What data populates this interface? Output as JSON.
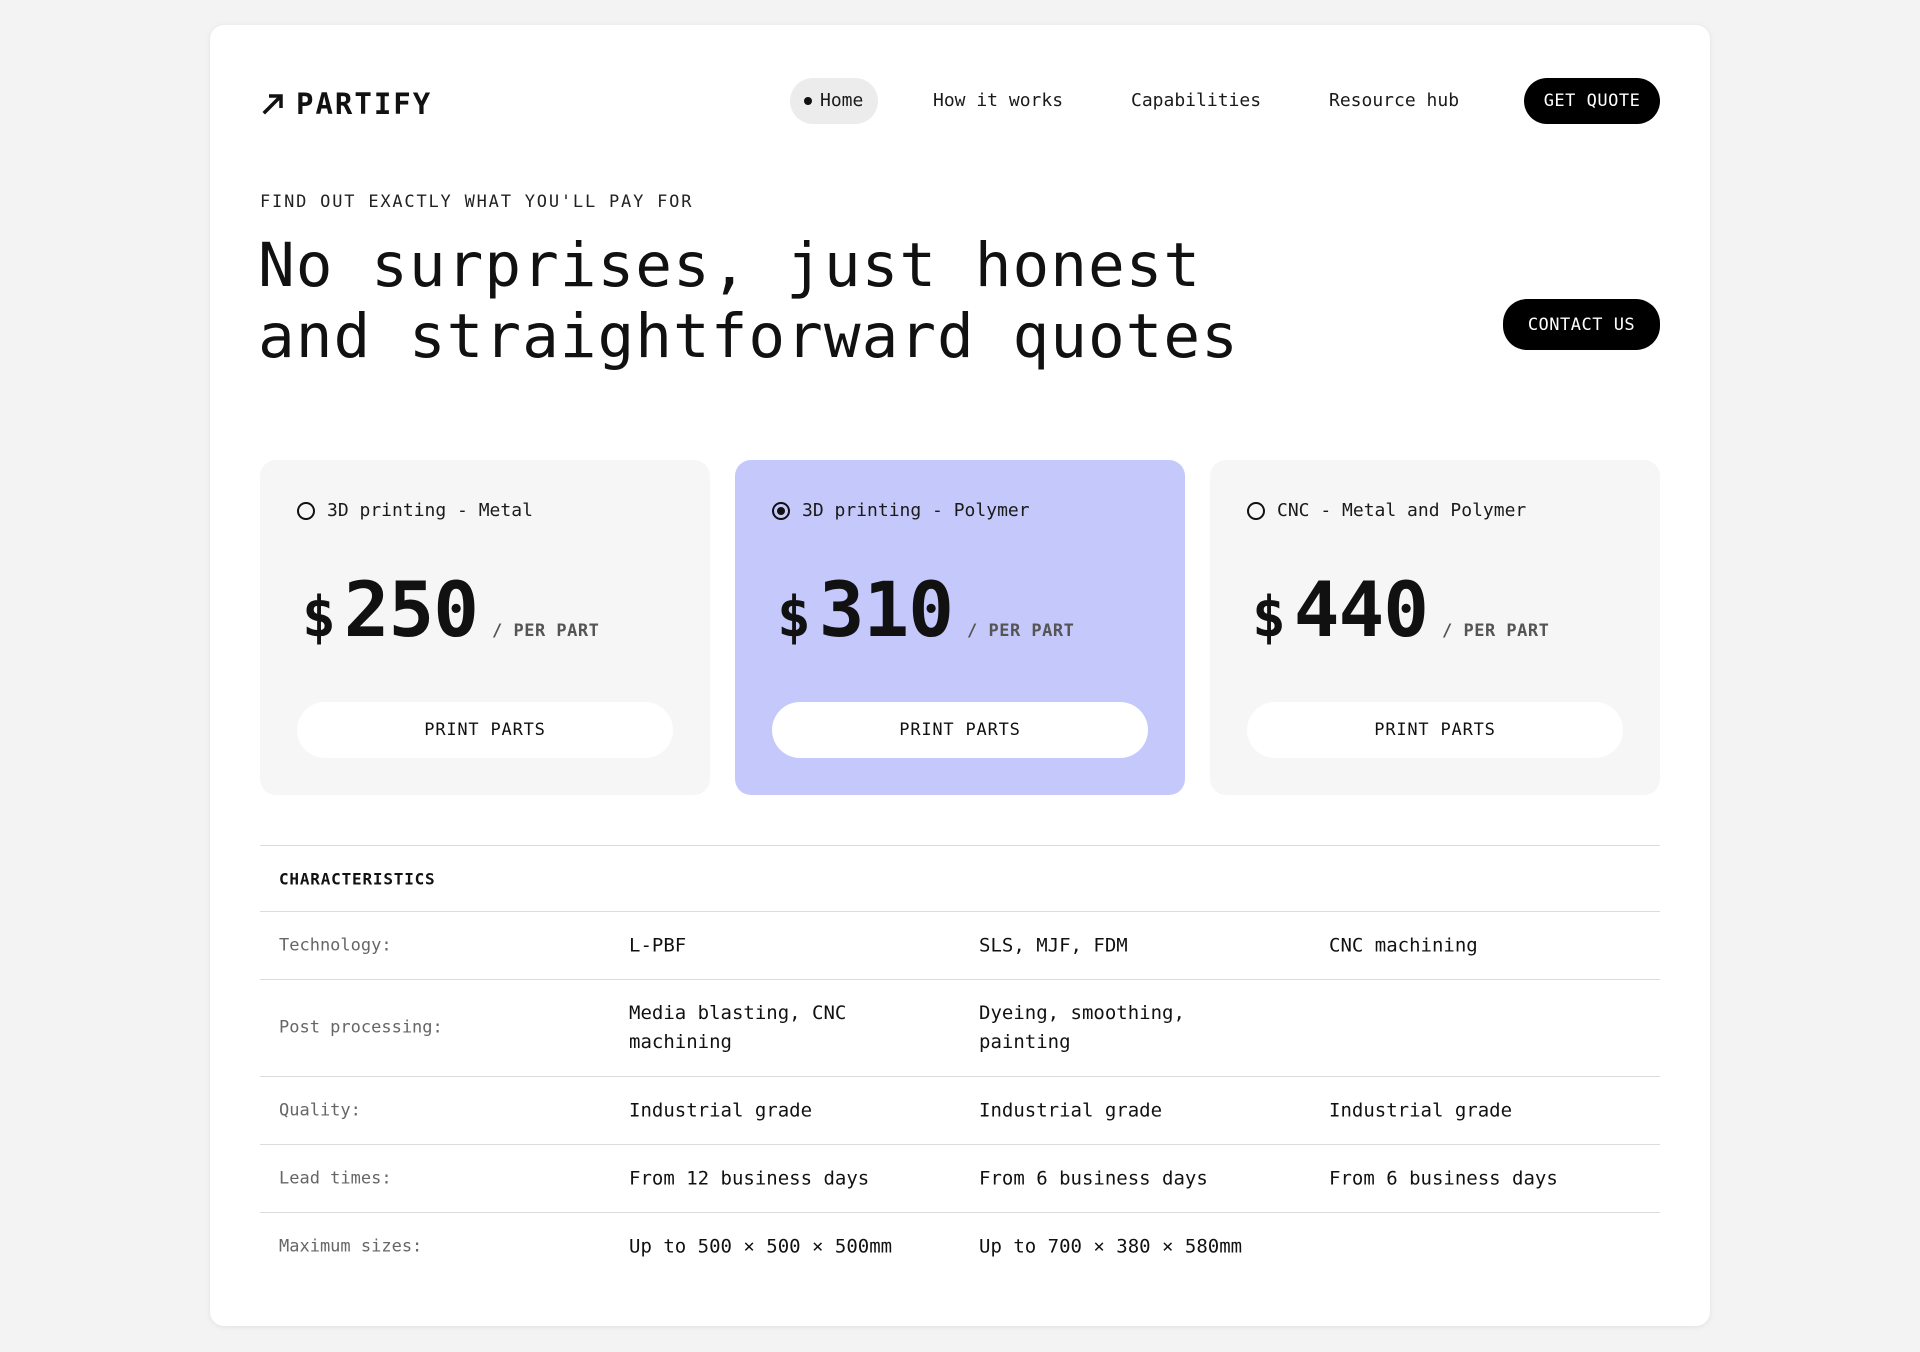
{
  "brand": {
    "name": "PARTIFY",
    "icon": "arrow-up-right-icon"
  },
  "nav": {
    "items": [
      "Home",
      "How it works",
      "Capabilities",
      "Resource hub"
    ],
    "cta": "GET QUOTE"
  },
  "hero": {
    "eyebrow": "FIND OUT EXACTLY WHAT YOU'LL PAY FOR",
    "headline_line1": "No surprises, just honest",
    "headline_line2": "and straightforward quotes",
    "contact": "CONTACT US"
  },
  "plans": [
    {
      "name": "3D printing - Metal",
      "currency": "$",
      "price": "250",
      "unit": "/ PER PART",
      "button": "PRINT PARTS",
      "selected": false
    },
    {
      "name": "3D printing - Polymer",
      "currency": "$",
      "price": "310",
      "unit": "/ PER PART",
      "button": "PRINT PARTS",
      "selected": true
    },
    {
      "name": "CNC - Metal and Polymer",
      "currency": "$",
      "price": "440",
      "unit": "/ PER PART",
      "button": "PRINT PARTS",
      "selected": false
    }
  ],
  "colors": {
    "selected_plan": "#c5c8fb",
    "plan_bg": "#f6f6f6",
    "accent_dark": "#000000"
  },
  "characteristics": {
    "title": "CHARACTERISTICS",
    "rows": [
      {
        "label": "Technology:",
        "values": [
          "L-PBF",
          "SLS, MJF, FDM",
          "CNC machining"
        ]
      },
      {
        "label": "Post processing:",
        "values": [
          "Media blasting, CNC machining",
          "Dyeing, smoothing, painting",
          ""
        ]
      },
      {
        "label": "Quality:",
        "values": [
          "Industrial grade",
          "Industrial grade",
          "Industrial grade"
        ]
      },
      {
        "label": "Lead times:",
        "values": [
          "From 12 business days",
          "From 6 business days",
          "From 6 business days"
        ]
      },
      {
        "label": "Maximum sizes:",
        "values": [
          "Up to 500 × 500 × 500mm",
          "Up to 700 × 380 × 580mm",
          ""
        ]
      }
    ]
  }
}
